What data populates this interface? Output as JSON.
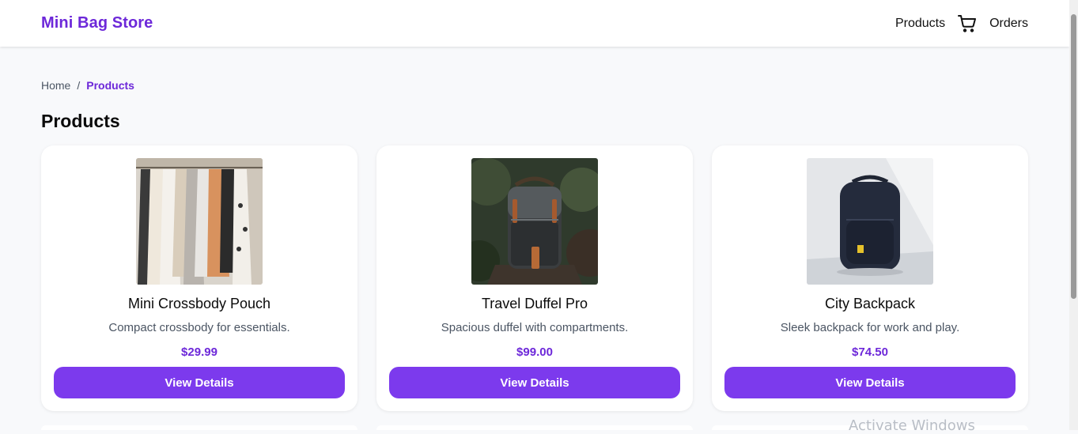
{
  "header": {
    "brand": "Mini Bag Store",
    "nav": {
      "products": "Products",
      "cart_icon": "cart-icon",
      "orders": "Orders"
    }
  },
  "breadcrumb": {
    "home": "Home",
    "separator": "/",
    "current": "Products"
  },
  "page": {
    "title": "Products"
  },
  "products": [
    {
      "name": "Mini Crossbody Pouch",
      "description": "Compact crossbody for essentials.",
      "price": "$29.99",
      "button": "View Details"
    },
    {
      "name": "Travel Duffel Pro",
      "description": "Spacious duffel with compartments.",
      "price": "$99.00",
      "button": "View Details"
    },
    {
      "name": "City Backpack",
      "description": "Sleek backpack for work and play.",
      "price": "$74.50",
      "button": "View Details"
    }
  ],
  "watermark": "Activate Windows",
  "colors": {
    "brand": "#6d28d9",
    "button": "#7c3aed",
    "background": "#f8f9fb"
  }
}
